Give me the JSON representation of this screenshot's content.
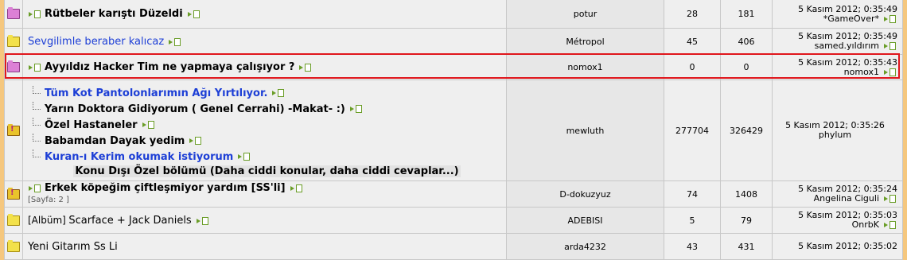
{
  "rows": [
    {
      "title": "Rütbeler karıştı Düzeldi",
      "author": "potur",
      "replies": "28",
      "views": "181",
      "date": "5 Kasım 2012; 0:35:49",
      "user": "*GameOver*"
    },
    {
      "title": "Sevgilimle beraber kalıcaz",
      "author": "Métropol",
      "replies": "45",
      "views": "406",
      "date": "5 Kasım 2012; 0:35:49",
      "user": "samed.yıldırım"
    },
    {
      "title": "Ayyıldız Hacker Tim ne yapmaya çalışıyor ?",
      "author": "nomox1",
      "replies": "0",
      "views": "0",
      "date": "5 Kasım 2012; 0:35:43",
      "user": "nomox1"
    },
    {
      "subs": [
        {
          "title": "Tüm Kot Pantolonlarımın Ağı Yırtılıyor."
        },
        {
          "title": "Yarın Doktora Gidiyorum ( Genel Cerrahi) -Makat- :)"
        },
        {
          "title": "Özel Hastaneler"
        },
        {
          "title": "Babamdan Dayak yedim"
        },
        {
          "title": "Kuran-ı Kerim okumak istiyorum"
        }
      ],
      "section": "Konu Dışı Özel bölümü (Daha ciddi konular, daha ciddi cevaplar...)",
      "author": "mewluth",
      "replies": "277704",
      "views": "326429",
      "date": "5 Kasım 2012; 0:35:26",
      "user": "phylum"
    },
    {
      "title": "Erkek köpeğim çiftleşmiyor yardım [SS'li]",
      "pages": "[Sayfa: 2 ]",
      "author": "D-dokuzyuz",
      "replies": "74",
      "views": "1408",
      "date": "5 Kasım 2012; 0:35:24",
      "user": "Angelina Ciguli"
    },
    {
      "prefix": "[Albüm]",
      "title": "Scarface + Jack Daniels",
      "author": "ADEBISI",
      "replies": "5",
      "views": "79",
      "date": "5 Kasım 2012; 0:35:03",
      "user": "OnrbK"
    },
    {
      "title": "Yeni Gitarım Ss Li",
      "author": "arda4232",
      "replies": "43",
      "views": "431",
      "date": "5 Kasım 2012; 0:35:02",
      "user": ""
    }
  ]
}
